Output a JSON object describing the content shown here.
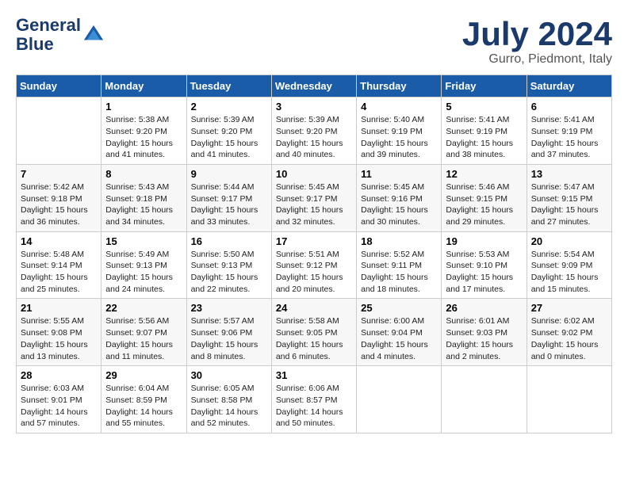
{
  "header": {
    "logo_line1": "General",
    "logo_line2": "Blue",
    "month_year": "July 2024",
    "location": "Gurro, Piedmont, Italy"
  },
  "weekdays": [
    "Sunday",
    "Monday",
    "Tuesday",
    "Wednesday",
    "Thursday",
    "Friday",
    "Saturday"
  ],
  "weeks": [
    [
      {
        "num": "",
        "info": ""
      },
      {
        "num": "1",
        "info": "Sunrise: 5:38 AM\nSunset: 9:20 PM\nDaylight: 15 hours\nand 41 minutes."
      },
      {
        "num": "2",
        "info": "Sunrise: 5:39 AM\nSunset: 9:20 PM\nDaylight: 15 hours\nand 41 minutes."
      },
      {
        "num": "3",
        "info": "Sunrise: 5:39 AM\nSunset: 9:20 PM\nDaylight: 15 hours\nand 40 minutes."
      },
      {
        "num": "4",
        "info": "Sunrise: 5:40 AM\nSunset: 9:19 PM\nDaylight: 15 hours\nand 39 minutes."
      },
      {
        "num": "5",
        "info": "Sunrise: 5:41 AM\nSunset: 9:19 PM\nDaylight: 15 hours\nand 38 minutes."
      },
      {
        "num": "6",
        "info": "Sunrise: 5:41 AM\nSunset: 9:19 PM\nDaylight: 15 hours\nand 37 minutes."
      }
    ],
    [
      {
        "num": "7",
        "info": "Sunrise: 5:42 AM\nSunset: 9:18 PM\nDaylight: 15 hours\nand 36 minutes."
      },
      {
        "num": "8",
        "info": "Sunrise: 5:43 AM\nSunset: 9:18 PM\nDaylight: 15 hours\nand 34 minutes."
      },
      {
        "num": "9",
        "info": "Sunrise: 5:44 AM\nSunset: 9:17 PM\nDaylight: 15 hours\nand 33 minutes."
      },
      {
        "num": "10",
        "info": "Sunrise: 5:45 AM\nSunset: 9:17 PM\nDaylight: 15 hours\nand 32 minutes."
      },
      {
        "num": "11",
        "info": "Sunrise: 5:45 AM\nSunset: 9:16 PM\nDaylight: 15 hours\nand 30 minutes."
      },
      {
        "num": "12",
        "info": "Sunrise: 5:46 AM\nSunset: 9:15 PM\nDaylight: 15 hours\nand 29 minutes."
      },
      {
        "num": "13",
        "info": "Sunrise: 5:47 AM\nSunset: 9:15 PM\nDaylight: 15 hours\nand 27 minutes."
      }
    ],
    [
      {
        "num": "14",
        "info": "Sunrise: 5:48 AM\nSunset: 9:14 PM\nDaylight: 15 hours\nand 25 minutes."
      },
      {
        "num": "15",
        "info": "Sunrise: 5:49 AM\nSunset: 9:13 PM\nDaylight: 15 hours\nand 24 minutes."
      },
      {
        "num": "16",
        "info": "Sunrise: 5:50 AM\nSunset: 9:13 PM\nDaylight: 15 hours\nand 22 minutes."
      },
      {
        "num": "17",
        "info": "Sunrise: 5:51 AM\nSunset: 9:12 PM\nDaylight: 15 hours\nand 20 minutes."
      },
      {
        "num": "18",
        "info": "Sunrise: 5:52 AM\nSunset: 9:11 PM\nDaylight: 15 hours\nand 18 minutes."
      },
      {
        "num": "19",
        "info": "Sunrise: 5:53 AM\nSunset: 9:10 PM\nDaylight: 15 hours\nand 17 minutes."
      },
      {
        "num": "20",
        "info": "Sunrise: 5:54 AM\nSunset: 9:09 PM\nDaylight: 15 hours\nand 15 minutes."
      }
    ],
    [
      {
        "num": "21",
        "info": "Sunrise: 5:55 AM\nSunset: 9:08 PM\nDaylight: 15 hours\nand 13 minutes."
      },
      {
        "num": "22",
        "info": "Sunrise: 5:56 AM\nSunset: 9:07 PM\nDaylight: 15 hours\nand 11 minutes."
      },
      {
        "num": "23",
        "info": "Sunrise: 5:57 AM\nSunset: 9:06 PM\nDaylight: 15 hours\nand 8 minutes."
      },
      {
        "num": "24",
        "info": "Sunrise: 5:58 AM\nSunset: 9:05 PM\nDaylight: 15 hours\nand 6 minutes."
      },
      {
        "num": "25",
        "info": "Sunrise: 6:00 AM\nSunset: 9:04 PM\nDaylight: 15 hours\nand 4 minutes."
      },
      {
        "num": "26",
        "info": "Sunrise: 6:01 AM\nSunset: 9:03 PM\nDaylight: 15 hours\nand 2 minutes."
      },
      {
        "num": "27",
        "info": "Sunrise: 6:02 AM\nSunset: 9:02 PM\nDaylight: 15 hours\nand 0 minutes."
      }
    ],
    [
      {
        "num": "28",
        "info": "Sunrise: 6:03 AM\nSunset: 9:01 PM\nDaylight: 14 hours\nand 57 minutes."
      },
      {
        "num": "29",
        "info": "Sunrise: 6:04 AM\nSunset: 8:59 PM\nDaylight: 14 hours\nand 55 minutes."
      },
      {
        "num": "30",
        "info": "Sunrise: 6:05 AM\nSunset: 8:58 PM\nDaylight: 14 hours\nand 52 minutes."
      },
      {
        "num": "31",
        "info": "Sunrise: 6:06 AM\nSunset: 8:57 PM\nDaylight: 14 hours\nand 50 minutes."
      },
      {
        "num": "",
        "info": ""
      },
      {
        "num": "",
        "info": ""
      },
      {
        "num": "",
        "info": ""
      }
    ]
  ]
}
